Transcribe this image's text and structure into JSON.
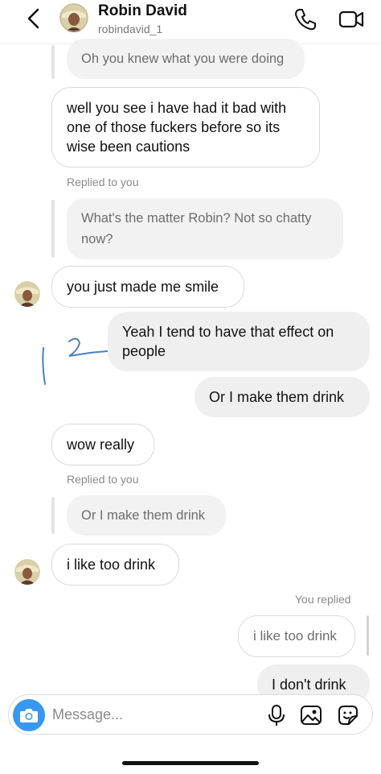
{
  "header": {
    "name": "Robin David",
    "username": "robindavid_1"
  },
  "messages": {
    "q1_text": "Oh you knew what you were doing",
    "m1_text": "well you see i have had it bad with one of those fuckers before so its wise been cautions",
    "replied_label_1": "Replied to you",
    "q2_text": "What's the matter Robin? Not so chatty now?",
    "m2_text": "you just made me smile",
    "m3_text": "Yeah I tend to have that effect on people",
    "m4_text": "Or I make them drink",
    "m5_text": "wow really",
    "replied_label_2": "Replied to you",
    "q3_text": "Or I make them drink",
    "m6_text": "i like too drink",
    "you_replied_label": "You replied",
    "q4_text": "i like too drink",
    "m7_text": "I don't drink"
  },
  "composer": {
    "placeholder": "Message..."
  },
  "icons": {
    "back": "chevron-left-icon",
    "call": "phone-icon",
    "video": "video-camera-icon",
    "camera": "camera-icon",
    "mic": "microphone-icon",
    "gallery": "image-icon",
    "sticker": "sticker-icon"
  },
  "colors": {
    "accent": "#3897f0",
    "outgoing_bubble": "#efefef",
    "incoming_border": "#dadada",
    "scribble": "#4a7fc1"
  }
}
